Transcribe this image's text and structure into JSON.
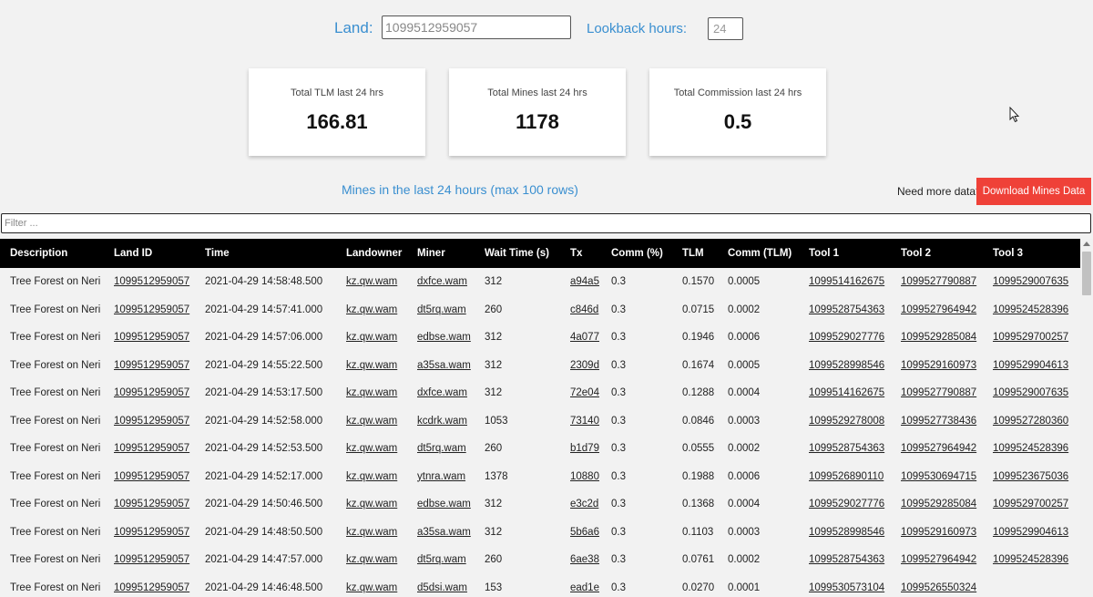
{
  "search": {
    "land_label": "Land:",
    "land_value": "1099512959057",
    "lookback_label": "Lookback hours:",
    "lookback_value": "24"
  },
  "stats": [
    {
      "title": "Total TLM last 24 hrs",
      "value": "166.81"
    },
    {
      "title": "Total Mines last 24 hrs",
      "value": "1178"
    },
    {
      "title": "Total Commission last 24 hrs",
      "value": "0.5"
    }
  ],
  "section_title": "Mines in the last 24 hours (max 100 rows)",
  "need_more_text": "Need more data?",
  "download_button": "Download Mines Data",
  "filter_placeholder": "Filter ...",
  "table": {
    "columns": [
      "Description",
      "Land ID",
      "Time",
      "Landowner",
      "Miner",
      "Wait Time (s)",
      "Tx",
      "Comm (%)",
      "TLM",
      "Comm (TLM)",
      "Tool 1",
      "Tool 2",
      "Tool 3"
    ],
    "rows": [
      [
        "Tree Forest on Neri",
        "1099512959057",
        "2021-04-29 14:58:48.500",
        "kz.qw.wam",
        "dxfce.wam",
        "312",
        "a94a5",
        "0.3",
        "0.1570",
        "0.0005",
        "1099514162675",
        "1099527790887",
        "1099529007635"
      ],
      [
        "Tree Forest on Neri",
        "1099512959057",
        "2021-04-29 14:57:41.000",
        "kz.qw.wam",
        "dt5rq.wam",
        "260",
        "c846d",
        "0.3",
        "0.0715",
        "0.0002",
        "1099528754363",
        "1099527964942",
        "1099524528396"
      ],
      [
        "Tree Forest on Neri",
        "1099512959057",
        "2021-04-29 14:57:06.000",
        "kz.qw.wam",
        "edbse.wam",
        "312",
        "4a077",
        "0.3",
        "0.1946",
        "0.0006",
        "1099529027776",
        "1099529285084",
        "1099529700257"
      ],
      [
        "Tree Forest on Neri",
        "1099512959057",
        "2021-04-29 14:55:22.500",
        "kz.qw.wam",
        "a35sa.wam",
        "312",
        "2309d",
        "0.3",
        "0.1674",
        "0.0005",
        "1099528998546",
        "1099529160973",
        "1099529904613"
      ],
      [
        "Tree Forest on Neri",
        "1099512959057",
        "2021-04-29 14:53:17.500",
        "kz.qw.wam",
        "dxfce.wam",
        "312",
        "72e04",
        "0.3",
        "0.1288",
        "0.0004",
        "1099514162675",
        "1099527790887",
        "1099529007635"
      ],
      [
        "Tree Forest on Neri",
        "1099512959057",
        "2021-04-29 14:52:58.000",
        "kz.qw.wam",
        "kcdrk.wam",
        "1053",
        "73140",
        "0.3",
        "0.0846",
        "0.0003",
        "1099529278008",
        "1099527738436",
        "1099527280360"
      ],
      [
        "Tree Forest on Neri",
        "1099512959057",
        "2021-04-29 14:52:53.500",
        "kz.qw.wam",
        "dt5rq.wam",
        "260",
        "b1d79",
        "0.3",
        "0.0555",
        "0.0002",
        "1099528754363",
        "1099527964942",
        "1099524528396"
      ],
      [
        "Tree Forest on Neri",
        "1099512959057",
        "2021-04-29 14:52:17.000",
        "kz.qw.wam",
        "ytnra.wam",
        "1378",
        "10880",
        "0.3",
        "0.1988",
        "0.0006",
        "1099526890110",
        "1099530694715",
        "1099523675036"
      ],
      [
        "Tree Forest on Neri",
        "1099512959057",
        "2021-04-29 14:50:46.500",
        "kz.qw.wam",
        "edbse.wam",
        "312",
        "e3c2d",
        "0.3",
        "0.1368",
        "0.0004",
        "1099529027776",
        "1099529285084",
        "1099529700257"
      ],
      [
        "Tree Forest on Neri",
        "1099512959057",
        "2021-04-29 14:48:50.500",
        "kz.qw.wam",
        "a35sa.wam",
        "312",
        "5b6a6",
        "0.3",
        "0.1103",
        "0.0003",
        "1099528998546",
        "1099529160973",
        "1099529904613"
      ],
      [
        "Tree Forest on Neri",
        "1099512959057",
        "2021-04-29 14:47:57.000",
        "kz.qw.wam",
        "dt5rq.wam",
        "260",
        "6ae38",
        "0.3",
        "0.0761",
        "0.0002",
        "1099528754363",
        "1099527964942",
        "1099524528396"
      ],
      [
        "Tree Forest on Neri",
        "1099512959057",
        "2021-04-29 14:46:48.500",
        "kz.qw.wam",
        "d5dsi.wam",
        "153",
        "ead1e",
        "0.3",
        "0.0270",
        "0.0001",
        "1099530573104",
        "1099526550324",
        ""
      ]
    ]
  }
}
